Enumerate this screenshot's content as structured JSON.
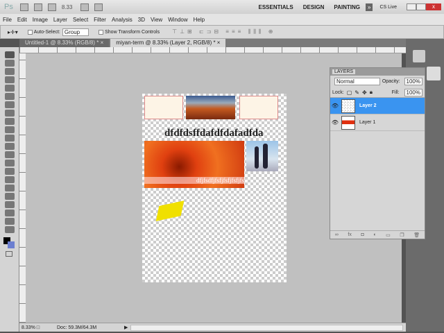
{
  "app": {
    "logo": "Ps",
    "zoom": "8.33",
    "workspaces": [
      "ESSENTIALS",
      "DESIGN",
      "PAINTING"
    ],
    "cs_live": "CS Live"
  },
  "menu": [
    "File",
    "Edit",
    "Image",
    "Layer",
    "Select",
    "Filter",
    "Analysis",
    "3D",
    "View",
    "Window",
    "Help"
  ],
  "options": {
    "auto_select_label": "Auto-Select:",
    "auto_select_value": "Group",
    "show_transform": "Show Transform Controls"
  },
  "tabs": [
    {
      "label": "Untitled-1 @ 8.33% (RGB/8) *"
    },
    {
      "label": "miyan-term @ 8.33% (Layer 2, RGB/8) *"
    }
  ],
  "document": {
    "headline": "dfdfdsffdafdfdafadfda",
    "caption": "dfjfsdfjfsfjfsfjfsfjfs"
  },
  "layers_panel": {
    "title": "LAYERS",
    "blend_mode": "Normal",
    "opacity_label": "Opacity:",
    "opacity": "100%",
    "lock_label": "Lock:",
    "fill_label": "Fill:",
    "fill": "100%",
    "layers": [
      {
        "name": "Layer 2",
        "selected": true
      },
      {
        "name": "Layer 1",
        "selected": false
      }
    ],
    "accent": "#3a94f0"
  },
  "status": {
    "zoom": "8.33%",
    "doc": "Doc: 59.3M/64.3M"
  }
}
